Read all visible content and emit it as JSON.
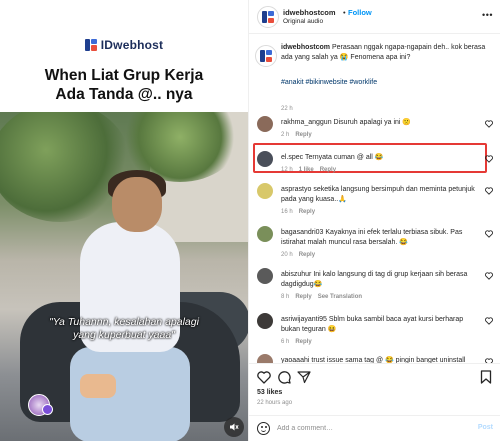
{
  "media": {
    "brand": "IDwebhost",
    "headline_line1": "When Liat Grup Kerja",
    "headline_line2": "Ada Tanda @.. nya",
    "subtitle_line1": "\"Ya Tuhannn, kesalahan apalagi",
    "subtitle_line2": "yang kuperbuat yaaa\"",
    "mute_icon": "speaker-muted-icon"
  },
  "header": {
    "username": "idwebhostcom",
    "dot": "•",
    "follow_label": "Follow",
    "audio_label": "Original audio",
    "more_icon": "more-horizontal-icon"
  },
  "caption": {
    "username": "idwebhostcom",
    "text": "Perasaan nggak ngapa-ngapain deh.. kok berasa ada yang salah ya 😭 Fenomena apa ini?",
    "tags": "#anakit #bikinwebsite #worklife",
    "time": "22 h"
  },
  "comments": [
    {
      "user": "rakhma_anggun",
      "text": "Disuruh apalagi ya ini 🙁",
      "time": "2 h",
      "likes": "",
      "reply": "Reply",
      "see_translation": "",
      "avatar_color": "#8a6a5a",
      "highlighted": true
    },
    {
      "user": "el.spec",
      "text": "Ternyata cuman @ all 😂",
      "time": "12 h",
      "likes": "1 like",
      "reply": "Reply",
      "see_translation": "",
      "avatar_color": "#4a4f5a",
      "highlighted": false
    },
    {
      "user": "asprastyo",
      "text": "seketika langsung bersimpuh dan meminta petunjuk pada yang kuasa..🙏",
      "time": "16 h",
      "likes": "",
      "reply": "Reply",
      "see_translation": "",
      "avatar_color": "#d8c86a",
      "highlighted": false
    },
    {
      "user": "bagasandri03",
      "text": "Kayaknya ini efek terlalu terbiasa sibuk. Pas istirahat malah muncul rasa bersalah. 😂",
      "time": "20 h",
      "likes": "",
      "reply": "Reply",
      "see_translation": "",
      "avatar_color": "#7a8f5a",
      "highlighted": false
    },
    {
      "user": "abiszuhur",
      "text": "Ini kalo langsung di tag di grup kerjaan sih berasa dagdigdug😂",
      "time": "8 h",
      "likes": "",
      "reply": "Reply",
      "see_translation": "See Translation",
      "avatar_color": "#5a5a5a",
      "highlighted": false
    },
    {
      "user": "asriwijayanti95",
      "text": "Sblm buka sambil baca ayat kursi berharap bukan teguran 😆",
      "time": "6 h",
      "likes": "",
      "reply": "Reply",
      "see_translation": "",
      "avatar_color": "#3d3a38",
      "highlighted": false
    },
    {
      "user": "yaoaaahi",
      "text": "trust issue sama tag @ 😂 pingin banget uninstall",
      "time": "",
      "likes": "",
      "reply": "",
      "see_translation": "",
      "avatar_color": "#9a7a6a",
      "highlighted": false
    }
  ],
  "actions": {
    "like_icon": "heart-icon",
    "comment_icon": "comment-icon",
    "share_icon": "send-icon",
    "save_icon": "bookmark-icon",
    "likes": "53 likes",
    "posted": "22 hours ago"
  },
  "add_comment": {
    "emoji_icon": "emoji-icon",
    "placeholder": "Add a comment…",
    "post_label": "Post"
  },
  "colors": {
    "accent": "#0095f6",
    "highlight": "#e53935",
    "muted": "#8e8e8e",
    "text": "#262626"
  }
}
